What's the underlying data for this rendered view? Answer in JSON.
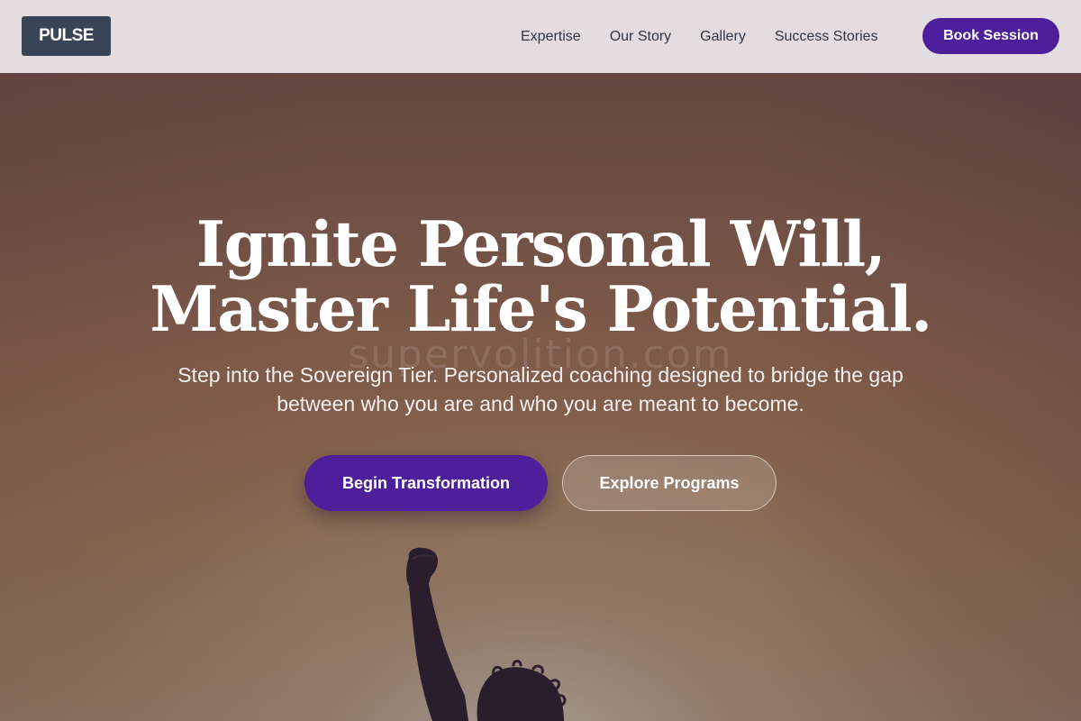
{
  "nav": {
    "logo": "PULSE",
    "links": [
      "Expertise",
      "Our Story",
      "Gallery",
      "Success Stories"
    ],
    "cta": "Book Session"
  },
  "hero": {
    "title_line1": "Ignite Personal Will,",
    "title_line2": "Master Life's Potential.",
    "subtitle": "Step into the Sovereign Tier. Personalized coaching designed to bridge the gap between who you are and who you are meant to become.",
    "primary_button": "Begin Transformation",
    "secondary_button": "Explore Programs",
    "watermark": "supervolition.com",
    "image_subject": "person-raised-fist-silhouette"
  },
  "colors": {
    "accent": "#4d1f9a",
    "logo_bg": "#3a4457",
    "nav_bg": "#e8e2e4",
    "nav_text": "#2f3644"
  }
}
